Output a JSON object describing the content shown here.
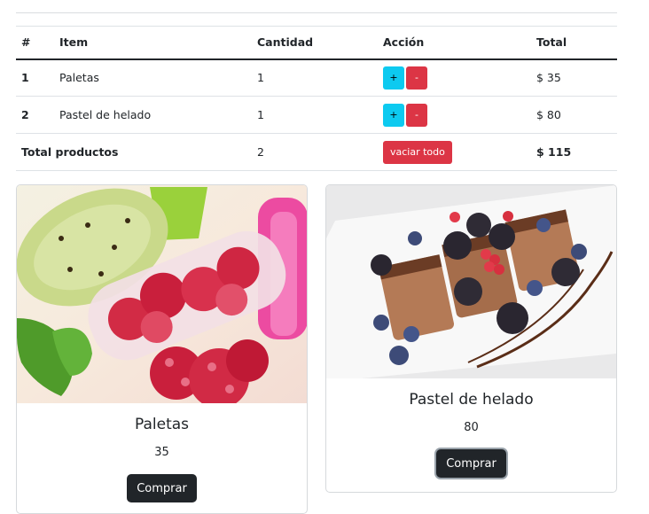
{
  "table": {
    "headers": {
      "num": "#",
      "item": "Item",
      "qty": "Cantidad",
      "action": "Acción",
      "total": "Total"
    },
    "rows": [
      {
        "id": "1",
        "item": "Paletas",
        "qty": "1",
        "plus": "+",
        "minus": "-",
        "total": "$ 35"
      },
      {
        "id": "2",
        "item": "Pastel de helado",
        "qty": "1",
        "plus": "+",
        "minus": "-",
        "total": "$ 80"
      }
    ],
    "footer": {
      "label": "Total productos",
      "qty": "2",
      "clear_label": "vaciar todo",
      "total": "$ 115"
    }
  },
  "products": [
    {
      "title": "Paletas",
      "price": "35",
      "button": "Comprar"
    },
    {
      "title": "Pastel de helado",
      "price": "80",
      "button": "Comprar"
    }
  ],
  "colors": {
    "info": "#0dcaf0",
    "danger": "#dc3545",
    "dark": "#212529"
  }
}
